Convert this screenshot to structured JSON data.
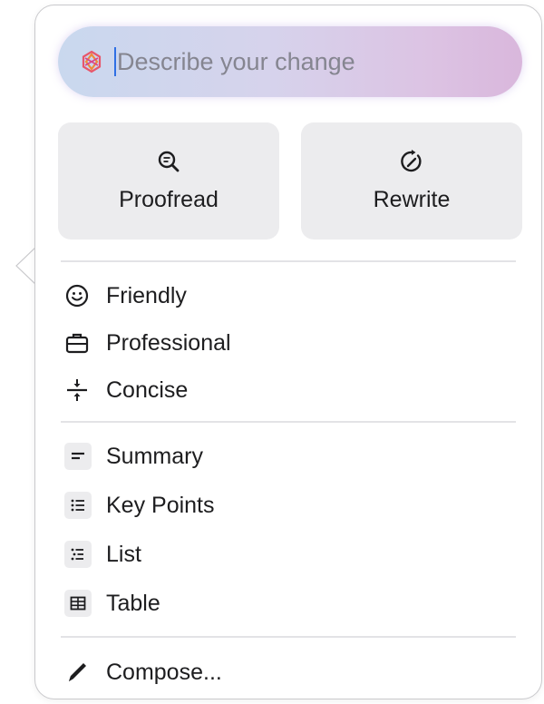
{
  "prompt": {
    "placeholder": "Describe your change",
    "icon": "writing-tools-icon"
  },
  "actions": [
    {
      "label": "Proofread",
      "icon": "magnifier-doc-icon"
    },
    {
      "label": "Rewrite",
      "icon": "rewrite-arrow-icon"
    }
  ],
  "tone_items": [
    {
      "label": "Friendly",
      "icon": "smiley-icon"
    },
    {
      "label": "Professional",
      "icon": "briefcase-icon"
    },
    {
      "label": "Concise",
      "icon": "compress-icon"
    }
  ],
  "format_items": [
    {
      "label": "Summary",
      "icon": "summary-icon"
    },
    {
      "label": "Key Points",
      "icon": "key-points-icon"
    },
    {
      "label": "List",
      "icon": "list-icon"
    },
    {
      "label": "Table",
      "icon": "table-icon"
    }
  ],
  "compose": {
    "label": "Compose...",
    "icon": "pencil-icon"
  },
  "colors": {
    "field_gradient_start": "#c9d8ee",
    "field_gradient_end": "#d9b7dc",
    "caret": "#2f6fe4",
    "button_bg": "#ececee"
  }
}
